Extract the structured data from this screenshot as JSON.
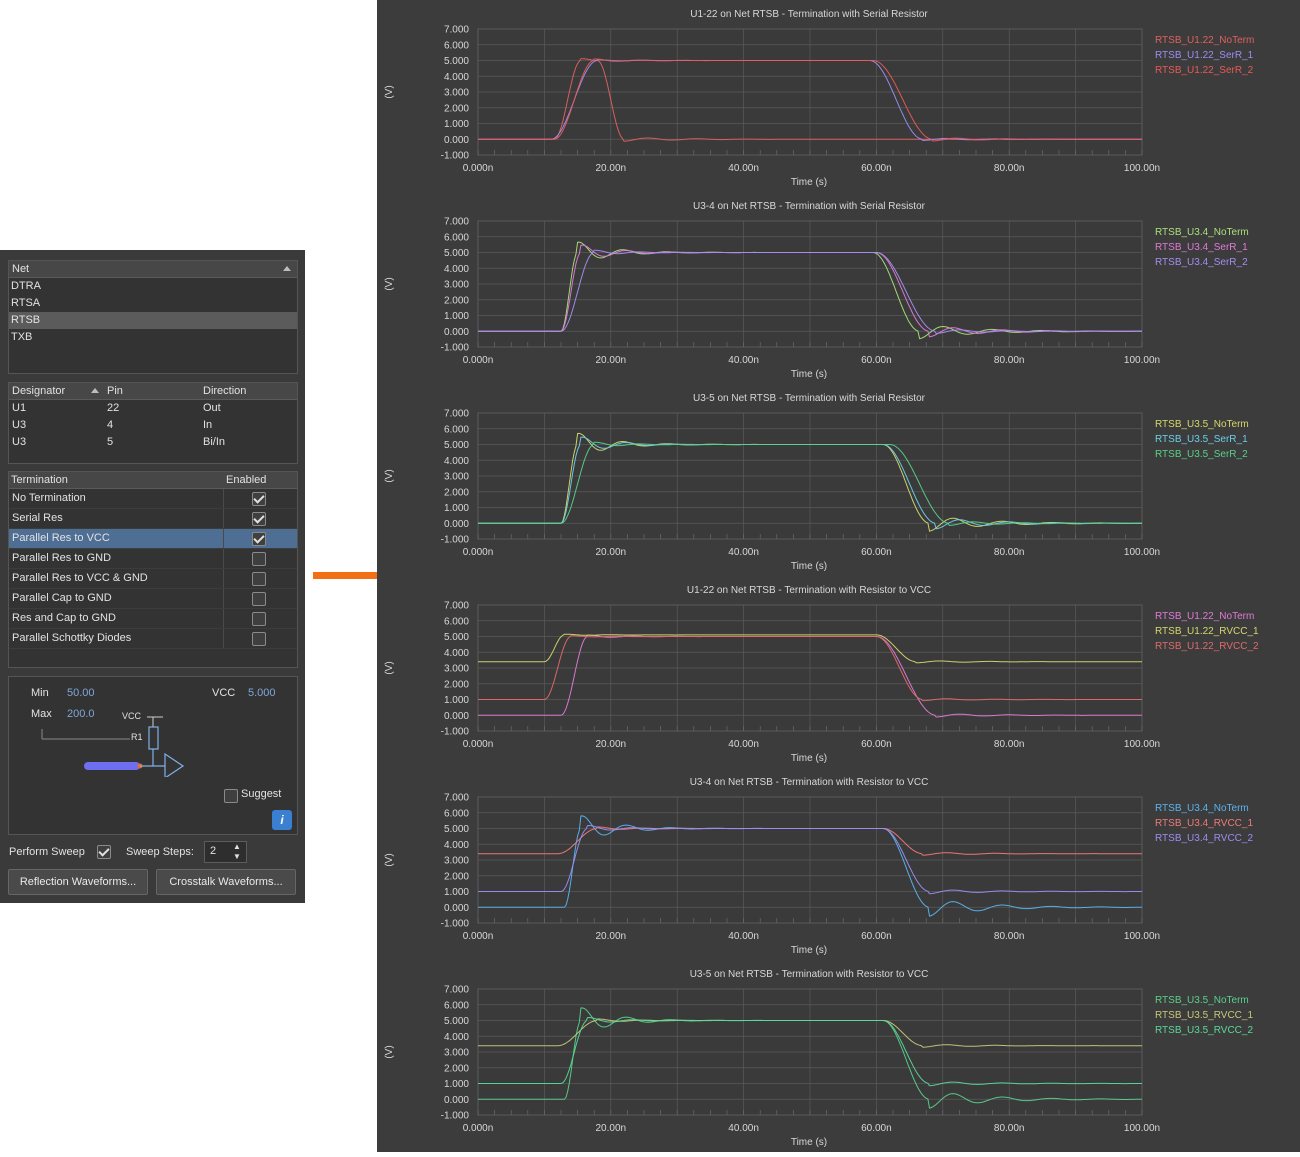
{
  "net_list": {
    "header": "Net",
    "items": [
      "DTRA",
      "RTSA",
      "RTSB",
      "TXB"
    ],
    "selected": "RTSB"
  },
  "pin_table": {
    "headers": [
      "Designator",
      "Pin",
      "Direction"
    ],
    "rows": [
      [
        "U1",
        "22",
        "Out"
      ],
      [
        "U3",
        "4",
        "In"
      ],
      [
        "U3",
        "5",
        "Bi/In"
      ]
    ]
  },
  "termination_table": {
    "headers": [
      "Termination",
      "Enabled"
    ],
    "rows": [
      {
        "label": "No Termination",
        "enabled": true
      },
      {
        "label": "Serial Res",
        "enabled": true
      },
      {
        "label": "Parallel Res to VCC",
        "enabled": true,
        "selected": true
      },
      {
        "label": "Parallel Res to GND",
        "enabled": false
      },
      {
        "label": "Parallel Res to VCC & GND",
        "enabled": false
      },
      {
        "label": "Parallel Cap to GND",
        "enabled": false
      },
      {
        "label": "Res and Cap to GND",
        "enabled": false
      },
      {
        "label": "Parallel Schottky Diodes",
        "enabled": false
      }
    ]
  },
  "params": {
    "min_label": "Min",
    "min_value": "50.00",
    "max_label": "Max",
    "max_value": "200.0",
    "vcc_label": "VCC",
    "vcc_value": "5.000",
    "schematic_vcc": "VCC",
    "schematic_r": "R1",
    "suggest_label": "Suggest"
  },
  "sweep": {
    "perform_label": "Perform Sweep",
    "perform_checked": true,
    "steps_label": "Sweep Steps:",
    "steps_value": "2"
  },
  "buttons": {
    "reflection": "Reflection Waveforms...",
    "crosstalk": "Crosstalk Waveforms..."
  },
  "chart_data": [
    {
      "type": "line",
      "title": "U1-22 on Net RTSB - Termination with Serial Resistor",
      "xlabel": "Time (s)",
      "ylabel": "(V)",
      "xlim": [
        0,
        100
      ],
      "ylim": [
        -1,
        7
      ],
      "yticks": [
        "7.000",
        "6.000",
        "5.000",
        "4.000",
        "3.000",
        "2.000",
        "1.000",
        "0.000",
        "-1.000"
      ],
      "xticks": [
        "0.000n",
        "20.00n",
        "40.00n",
        "60.00n",
        "80.00n",
        "100.00n"
      ],
      "series": [
        {
          "name": "RTSB_U1.22_NoTerm",
          "color": "#e06060"
        },
        {
          "name": "RTSB_U1.22_SerR_1",
          "color": "#9a8ef2"
        },
        {
          "name": "RTSB_U1.22_SerR_2",
          "color": "#e85a5a"
        }
      ]
    },
    {
      "type": "line",
      "title": "U3-4 on Net RTSB - Termination with Serial Resistor",
      "xlabel": "Time (s)",
      "ylabel": "(V)",
      "xlim": [
        0,
        100
      ],
      "ylim": [
        -1,
        7
      ],
      "yticks": [
        "7.000",
        "6.000",
        "5.000",
        "4.000",
        "3.000",
        "2.000",
        "1.000",
        "0.000",
        "-1.000"
      ],
      "xticks": [
        "0.000n",
        "20.00n",
        "40.00n",
        "60.00n",
        "80.00n",
        "100.00n"
      ],
      "series": [
        {
          "name": "RTSB_U3.4_NoTerm",
          "color": "#a9e07a"
        },
        {
          "name": "RTSB_U3.4_SerR_1",
          "color": "#e07ad8"
        },
        {
          "name": "RTSB_U3.4_SerR_2",
          "color": "#a48ef2"
        }
      ]
    },
    {
      "type": "line",
      "title": "U3-5 on Net RTSB - Termination with Serial Resistor",
      "xlabel": "Time (s)",
      "ylabel": "(V)",
      "xlim": [
        0,
        100
      ],
      "ylim": [
        -1,
        7
      ],
      "yticks": [
        "7.000",
        "6.000",
        "5.000",
        "4.000",
        "3.000",
        "2.000",
        "1.000",
        "0.000",
        "-1.000"
      ],
      "xticks": [
        "0.000n",
        "20.00n",
        "40.00n",
        "60.00n",
        "80.00n",
        "100.00n"
      ],
      "series": [
        {
          "name": "RTSB_U3.5_NoTerm",
          "color": "#d6d86a"
        },
        {
          "name": "RTSB_U3.5_SerR_1",
          "color": "#6ad0e8"
        },
        {
          "name": "RTSB_U3.5_SerR_2",
          "color": "#5ad08a"
        }
      ]
    },
    {
      "type": "line",
      "title": "U1-22 on Net RTSB - Termination with Resistor to VCC",
      "xlabel": "Time (s)",
      "ylabel": "(V)",
      "xlim": [
        0,
        100
      ],
      "ylim": [
        -1,
        7
      ],
      "yticks": [
        "7.000",
        "6.000",
        "5.000",
        "4.000",
        "3.000",
        "2.000",
        "1.000",
        "0.000",
        "-1.000"
      ],
      "xticks": [
        "0.000n",
        "20.00n",
        "40.00n",
        "60.00n",
        "80.00n",
        "100.00n"
      ],
      "series": [
        {
          "name": "RTSB_U1.22_NoTerm",
          "color": "#e07ad8"
        },
        {
          "name": "RTSB_U1.22_RVCC_1",
          "color": "#d6d86a"
        },
        {
          "name": "RTSB_U1.22_RVCC_2",
          "color": "#e06a6a"
        }
      ]
    },
    {
      "type": "line",
      "title": "U3-4 on Net RTSB - Termination with Resistor to VCC",
      "xlabel": "Time (s)",
      "ylabel": "(V)",
      "xlim": [
        0,
        100
      ],
      "ylim": [
        -1,
        7
      ],
      "yticks": [
        "7.000",
        "6.000",
        "5.000",
        "4.000",
        "3.000",
        "2.000",
        "1.000",
        "0.000",
        "-1.000"
      ],
      "xticks": [
        "0.000n",
        "20.00n",
        "40.00n",
        "60.00n",
        "80.00n",
        "100.00n"
      ],
      "series": [
        {
          "name": "RTSB_U3.4_NoTerm",
          "color": "#5ab4f0"
        },
        {
          "name": "RTSB_U3.4_RVCC_1",
          "color": "#f07a7a"
        },
        {
          "name": "RTSB_U3.4_RVCC_2",
          "color": "#9a8ef2"
        }
      ]
    },
    {
      "type": "line",
      "title": "U3-5 on Net RTSB - Termination with Resistor to VCC",
      "xlabel": "Time (s)",
      "ylabel": "(V)",
      "xlim": [
        0,
        100
      ],
      "ylim": [
        -1,
        7
      ],
      "yticks": [
        "7.000",
        "6.000",
        "5.000",
        "4.000",
        "3.000",
        "2.000",
        "1.000",
        "0.000",
        "-1.000"
      ],
      "xticks": [
        "0.000n",
        "20.00n",
        "40.00n",
        "60.00n",
        "80.00n",
        "100.00n"
      ],
      "series": [
        {
          "name": "RTSB_U3.5_NoTerm",
          "color": "#5ad08a"
        },
        {
          "name": "RTSB_U3.5_RVCC_1",
          "color": "#c8c87a"
        },
        {
          "name": "RTSB_U3.5_RVCC_2",
          "color": "#5ad898"
        }
      ]
    }
  ]
}
